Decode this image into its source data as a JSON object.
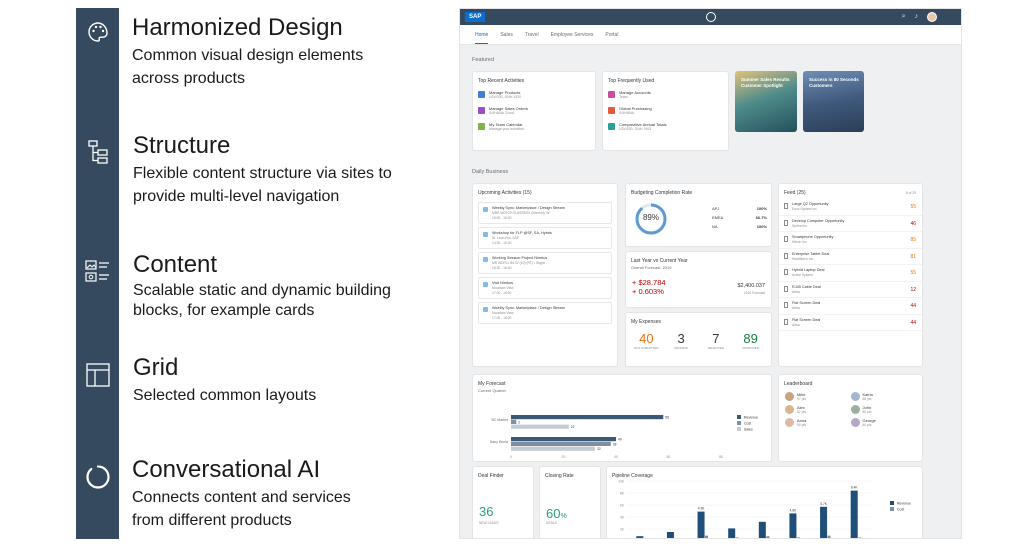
{
  "features": [
    {
      "title": "Harmonized Design",
      "desc": "Common visual design elements across products",
      "icon": "palette-icon"
    },
    {
      "title": "Structure",
      "desc": "Flexible content structure via sites to provide multi-level navigation",
      "icon": "hierarchy-icon"
    },
    {
      "title": "Content",
      "desc": "Scalable static and dynamic building blocks, for example cards",
      "icon": "content-cards-icon"
    },
    {
      "title": "Grid",
      "desc": "Selected common layouts",
      "icon": "grid-layout-icon"
    },
    {
      "title": "Conversational AI",
      "desc": "Connects content and services from different products",
      "icon": "conversational-ai-icon"
    }
  ],
  "launchpad": {
    "logo": "SAP",
    "tabs": [
      "Home",
      "Sales",
      "Travel",
      "Employee Services",
      "Portal"
    ],
    "featured_label": "Featured",
    "daily_label": "Daily Business",
    "recent": {
      "title": "Top Recent Activities",
      "items": [
        {
          "t1": "Manage Products",
          "t2": "U3V/030, S/4H 1920",
          "color": "#3f80d0"
        },
        {
          "t1": "Manage Sales Orders",
          "t2": "S/4HANA Cloud",
          "color": "#9b4fc4"
        },
        {
          "t1": "My Team Calendar",
          "t2": "Manage your activities",
          "color": "#7fb24a"
        }
      ]
    },
    "frequent": {
      "title": "Top Frequently Used",
      "items": [
        {
          "t1": "Manage Accounts",
          "t2": "Team",
          "color": "#c74ea0"
        },
        {
          "t1": "Global Purchasing",
          "t2": "S/4HANA",
          "color": "#e05a3c"
        },
        {
          "t1": "Comparative Annual Totals",
          "t2": "U3V/030, S/4H 1903",
          "color": "#2a9e9a"
        }
      ]
    },
    "tile1": {
      "label": "Summer Sales Results Customer Spotlight"
    },
    "tile2": {
      "label": "Success in 80 Seconds Customers"
    },
    "upcoming": {
      "title": "Upcoming Activities (15)",
      "items": [
        {
          "t1": "Weekly Sync: Marketplace / Design Stream",
          "t2": "MRR WDF29 GLASSBOX (Internal), W.",
          "t3": "16:00 - 16:30"
        },
        {
          "t1": "Workshop for FLP @SF, SA, Hybris",
          "t2": "St. Leon-Rot, SAP",
          "t3": "14:30 - 16:30"
        },
        {
          "t1": "Working Session Project Nimbus",
          "t2": "MR WDF01 B5.02 (10) (RT) • Skype",
          "t3": "16:30 - 16:30"
        },
        {
          "t1": "Visit Nimbus",
          "t2": "Mountain View",
          "t3": "17:00 - 16:30"
        },
        {
          "t1": "Weekly Sync: Marketplace / Design Stream",
          "t2": "Mountain View",
          "t3": "17:00 - 18:30"
        }
      ]
    },
    "budget": {
      "title": "Budgeting Completion Rate",
      "percent": "89%",
      "rows": [
        {
          "k": "APJ",
          "v": "100%"
        },
        {
          "k": "EMEA",
          "v": "66.7%"
        },
        {
          "k": "NA",
          "v": "100%"
        }
      ]
    },
    "lastyear": {
      "title": "Last Year vs Current Year",
      "sub": "Overall Forecast, 2019",
      "delta1": "+ $28.784",
      "delta2": "+ 0.603%",
      "total": "$2,400.037",
      "total_sub": "2019 Forecast"
    },
    "expenses": {
      "title": "My Expenses",
      "kpis": [
        {
          "v": "40",
          "l": "NOT SUBMITTED",
          "color": "#e9730c"
        },
        {
          "v": "3",
          "l": "PENDING",
          "color": "#32363a"
        },
        {
          "v": "7",
          "l": "REJECTED",
          "color": "#32363a"
        },
        {
          "v": "89",
          "l": "APPROVED",
          "color": "#107e3e"
        }
      ]
    },
    "feed": {
      "title": "Feed (25)",
      "count": "8 of 25",
      "items": [
        {
          "t1": "Large Q2 Opportunity",
          "t2": "Kooz System Inc.",
          "n": "55",
          "color": "#e9730c"
        },
        {
          "t1": "Develop Computer Opportunity",
          "t2": "Sphira Inc.",
          "n": "46",
          "color": "#bb0000"
        },
        {
          "t1": "Smartphone Opportunity",
          "t2": "Hitech Inc.",
          "n": "85",
          "color": "#e9730c"
        },
        {
          "t1": "Enterprise Tablet Deal",
          "t2": "Healthtech Inc.",
          "n": "81",
          "color": "#e9730c"
        },
        {
          "t1": "Hybrid Laptop Deal",
          "t2": "Active System",
          "n": "55",
          "color": "#e9730c"
        },
        {
          "t1": "RJ45 Cable Deal",
          "t2": "Artsa",
          "n": "12",
          "color": "#bb0000"
        },
        {
          "t1": "Flat Screen Deal",
          "t2": "Artsa",
          "n": "44",
          "color": "#bb0000"
        },
        {
          "t1": "Flat Screen Deal",
          "t2": "Artsa",
          "n": "44",
          "color": "#bb0000"
        }
      ]
    },
    "leaderboard": {
      "title": "Leaderboard",
      "people": [
        {
          "name": "Mike",
          "v": "97 pts"
        },
        {
          "name": "Katrin",
          "v": "88 pts"
        },
        {
          "name": "Alex",
          "v": "92 pts"
        },
        {
          "name": "John",
          "v": "80 pts"
        },
        {
          "name": "Anna",
          "v": "90 pts"
        },
        {
          "name": "George",
          "v": "80 pts"
        }
      ]
    },
    "forecast": {
      "title": "My Forecast",
      "sub": "Current Quarter",
      "legend": [
        "Revenue",
        "Cost",
        "Sales"
      ]
    },
    "deal": {
      "title": "Deal Finder",
      "v": "36",
      "l": "NEW LEADS"
    },
    "closing": {
      "title": "Closing Rate",
      "v": "60",
      "unit": "%",
      "l": "DEALS"
    },
    "pipeline": {
      "title": "Pipeline Coverage",
      "legend": [
        "Revenue",
        "Cost"
      ]
    }
  },
  "chart_data": [
    {
      "type": "bar",
      "title": "My Forecast",
      "subtitle": "Current Quarter",
      "categories": [
        "BC Market",
        "Dairy World"
      ],
      "series": [
        {
          "name": "Revenue",
          "values": [
            58,
            40
          ]
        },
        {
          "name": "Cost",
          "values": [
            2,
            38
          ]
        },
        {
          "name": "Sales",
          "values": [
            22,
            32
          ]
        }
      ],
      "x_ticks": [
        "0",
        "20",
        "40",
        "60",
        "80"
      ],
      "xlim": [
        0,
        80
      ],
      "colors": [
        "#3b5875",
        "#7f8fa3",
        "#c3ccd6"
      ]
    },
    {
      "type": "bar",
      "title": "Pipeline Coverage",
      "categories": [
        "1",
        "2",
        "3",
        "4",
        "5",
        "6",
        "7",
        "8"
      ],
      "series": [
        {
          "name": "Revenue",
          "values": [
            0.8,
            1.5,
            4.9,
            2.1,
            3.2,
            4.6,
            5.7,
            8.4
          ]
        },
        {
          "name": "Cost",
          "values": [
            0.3,
            0.5,
            0.9,
            0.6,
            0.8,
            0.6,
            0.9,
            0.6
          ]
        }
      ],
      "data_labels": [
        "4.9K",
        "4.6K",
        "5.7K",
        "8.4K"
      ],
      "y_ticks": [
        "10K",
        "8K",
        "6K",
        "4K",
        "2K",
        "0"
      ],
      "ylim": [
        0,
        10
      ],
      "colors": [
        "#1f4e79",
        "#7f8fa3"
      ]
    }
  ]
}
